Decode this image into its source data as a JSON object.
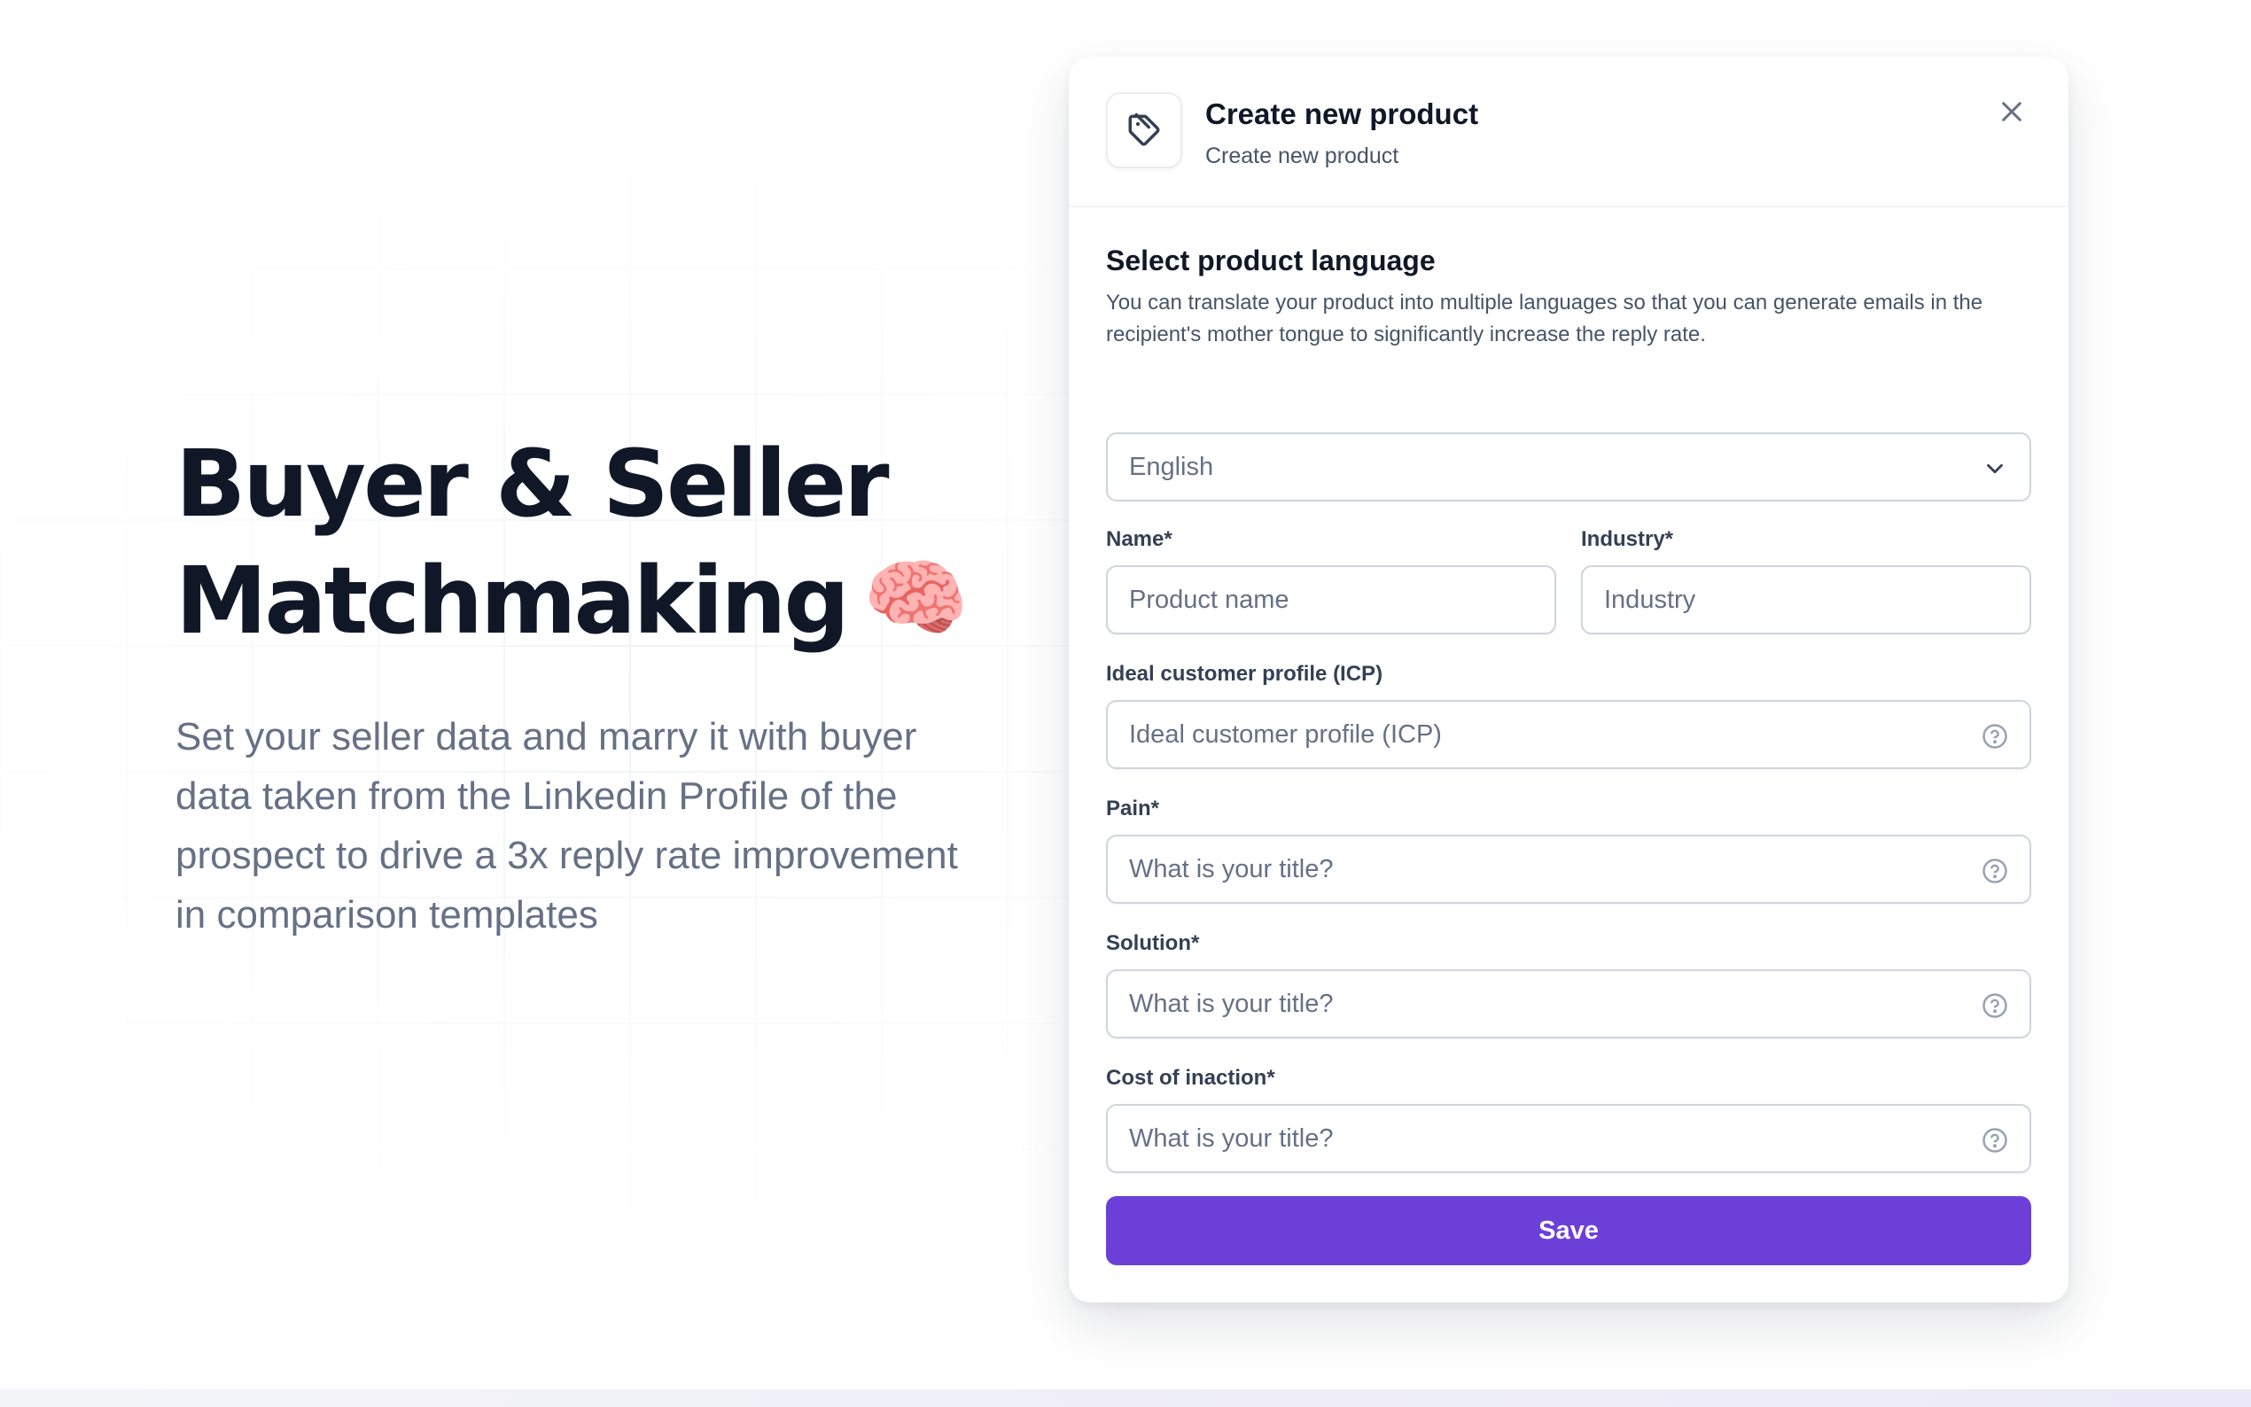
{
  "hero": {
    "title_line1": "Buyer & Seller",
    "title_line2": "Matchmaking",
    "emoji": "🧠",
    "description": "Set your seller data and marry it with buyer data taken from the Linkedin Profile of the prospect to drive a 3x reply rate improvement in comparison templates"
  },
  "modal": {
    "icon": "tag-icon",
    "title": "Create new product",
    "subtitle": "Create new product",
    "close_icon": "close-icon"
  },
  "language": {
    "title": "Select product language",
    "description": "You can translate your product into multiple languages so that you can generate emails in the recipient's mother tongue to significantly increase the reply rate.",
    "selected": "English"
  },
  "fields": {
    "name": {
      "label": "Name*",
      "placeholder": "Product name"
    },
    "industry": {
      "label": "Industry*",
      "placeholder": "Industry"
    },
    "icp": {
      "label": "Ideal customer profile (ICP)",
      "placeholder": "Ideal customer profile (ICP)"
    },
    "pain": {
      "label": "Pain*",
      "placeholder": "What is your title?"
    },
    "solution": {
      "label": "Solution*",
      "placeholder": "What is your title?"
    },
    "cost": {
      "label": "Cost of inaction*",
      "placeholder": "What is your title?"
    }
  },
  "actions": {
    "save_label": "Save"
  },
  "colors": {
    "primary": "#6d3fd9",
    "border": "#d0d5dd",
    "text": "#101828",
    "muted": "#667085"
  }
}
